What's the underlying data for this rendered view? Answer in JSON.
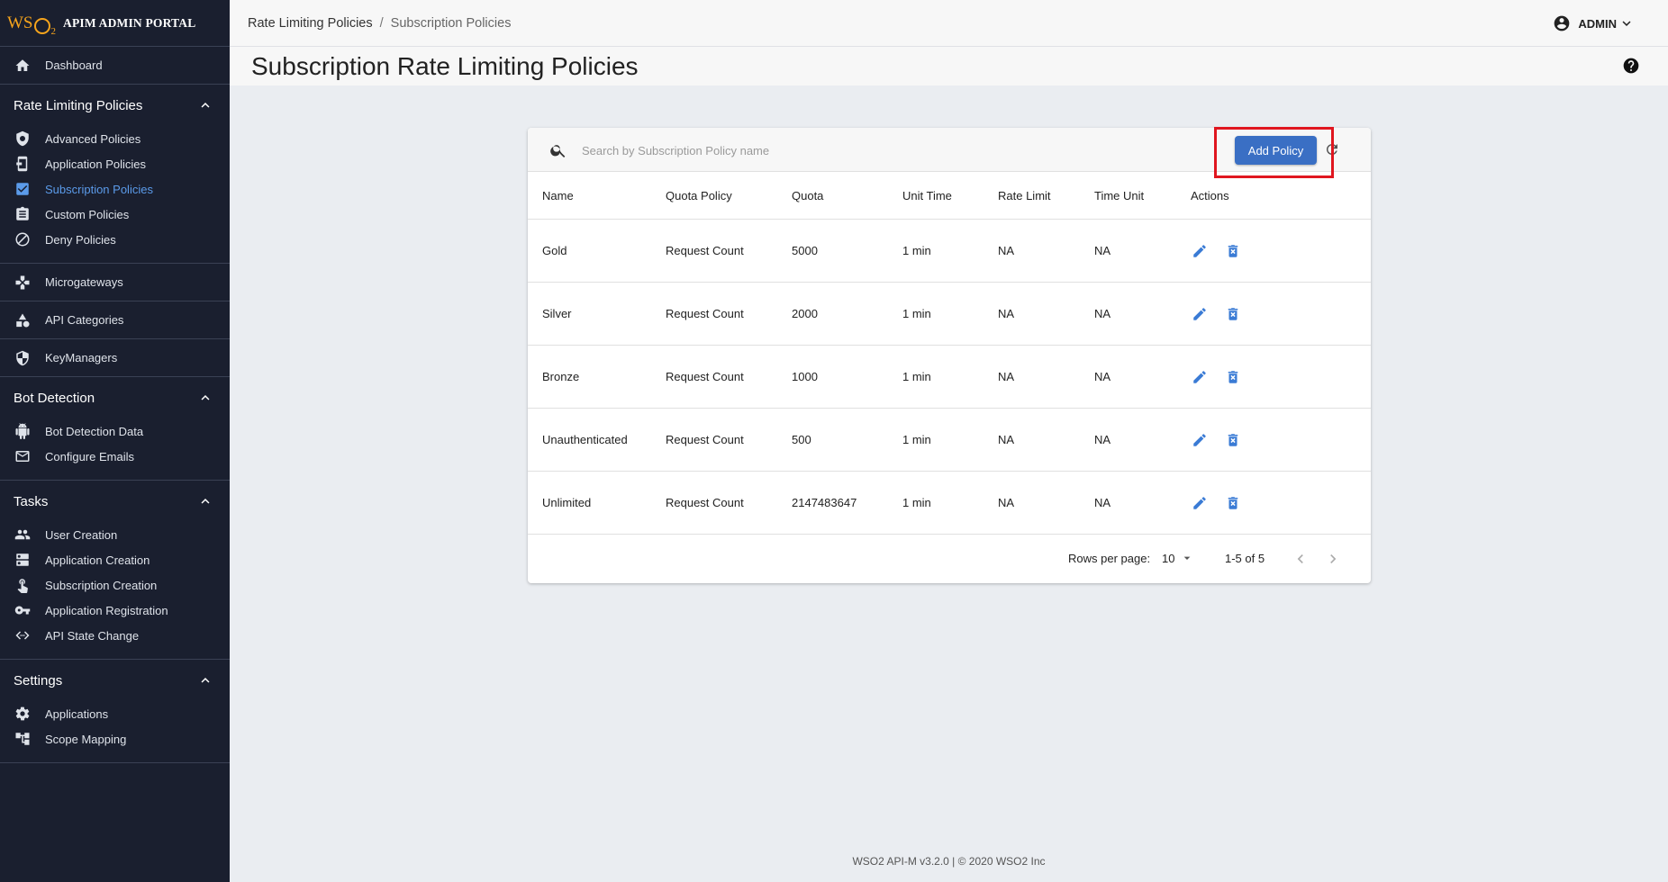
{
  "brand": {
    "logo": "WSO2",
    "title": "APIM ADMIN PORTAL"
  },
  "sidebar": {
    "dashboard": "Dashboard",
    "rate_limiting": {
      "title": "Rate Limiting Policies",
      "items": [
        "Advanced Policies",
        "Application Policies",
        "Subscription Policies",
        "Custom Policies",
        "Deny Policies"
      ]
    },
    "microgateways": "Microgateways",
    "api_categories": "API Categories",
    "keymanagers": "KeyManagers",
    "bot_detection": {
      "title": "Bot Detection",
      "items": [
        "Bot Detection Data",
        "Configure Emails"
      ]
    },
    "tasks": {
      "title": "Tasks",
      "items": [
        "User Creation",
        "Application Creation",
        "Subscription Creation",
        "Application Registration",
        "API State Change"
      ]
    },
    "settings": {
      "title": "Settings",
      "items": [
        "Applications",
        "Scope Mapping"
      ]
    }
  },
  "breadcrumb": {
    "parent": "Rate Limiting Policies",
    "separator": "/",
    "current": "Subscription Policies"
  },
  "user": {
    "name": "ADMIN"
  },
  "page": {
    "title": "Subscription Rate Limiting Policies"
  },
  "search": {
    "placeholder": "Search by Subscription Policy name",
    "value": ""
  },
  "toolbar": {
    "add_label": "Add Policy"
  },
  "table": {
    "columns": [
      "Name",
      "Quota Policy",
      "Quota",
      "Unit Time",
      "Rate Limit",
      "Time Unit",
      "Actions"
    ],
    "rows": [
      [
        "Gold",
        "Request Count",
        "5000",
        "1 min",
        "NA",
        "NA"
      ],
      [
        "Silver",
        "Request Count",
        "2000",
        "1 min",
        "NA",
        "NA"
      ],
      [
        "Bronze",
        "Request Count",
        "1000",
        "1 min",
        "NA",
        "NA"
      ],
      [
        "Unauthenticated",
        "Request Count",
        "500",
        "1 min",
        "NA",
        "NA"
      ],
      [
        "Unlimited",
        "Request Count",
        "2147483647",
        "1 min",
        "NA",
        "NA"
      ]
    ]
  },
  "pagination": {
    "rows_per_page_label": "Rows per page:",
    "rows_per_page": "10",
    "range": "1-5 of 5"
  },
  "footer": {
    "text": "WSO2 API-M v3.2.0 | © 2020 WSO2 Inc"
  },
  "colors": {
    "sidebar_bg": "#1a1f2f",
    "accent": "#3a6fc4",
    "active_link": "#5b9bea",
    "highlight_box": "#e0161f"
  }
}
